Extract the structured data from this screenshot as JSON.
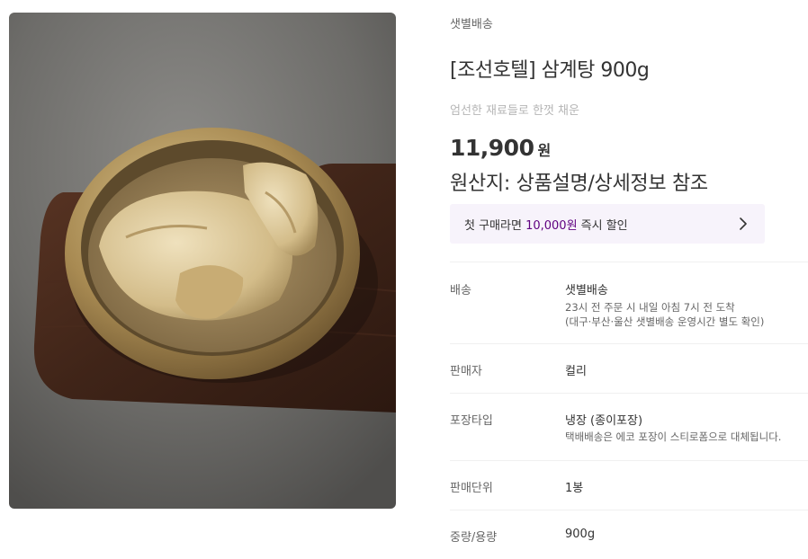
{
  "product": {
    "delivery_tag": "샛별배송",
    "title": "[조선호텔] 삼계탕 900g",
    "subtitle": "엄선한 재료들로 한껏 채운",
    "price": "11,900",
    "currency": "원",
    "origin": "원산지: 상품설명/상세정보 참조"
  },
  "coupon": {
    "prefix": "첫 구매라면 ",
    "amount": "10,000원",
    "suffix": " 즉시 할인",
    "icon": "chevron-right-icon"
  },
  "details": {
    "delivery": {
      "label": "배송",
      "value": "샛별배송",
      "desc1": "23시 전 주문 시 내일 아침 7시 전 도착",
      "desc2": "(대구·부산·울산 샛별배송 운영시간 별도 확인)"
    },
    "seller": {
      "label": "판매자",
      "value": "컬리"
    },
    "packaging": {
      "label": "포장타입",
      "value": "냉장 (종이포장)",
      "desc1": "택배배송은 에코 포장이 스티로폼으로 대체됩니다."
    },
    "unit": {
      "label": "판매단위",
      "value": "1봉"
    },
    "weight": {
      "label": "중량/용량",
      "value": "900g"
    }
  },
  "colors": {
    "accent": "#5f0080",
    "coupon_bg": "#f7f3fb",
    "muted_text": "#b5b5b5"
  }
}
